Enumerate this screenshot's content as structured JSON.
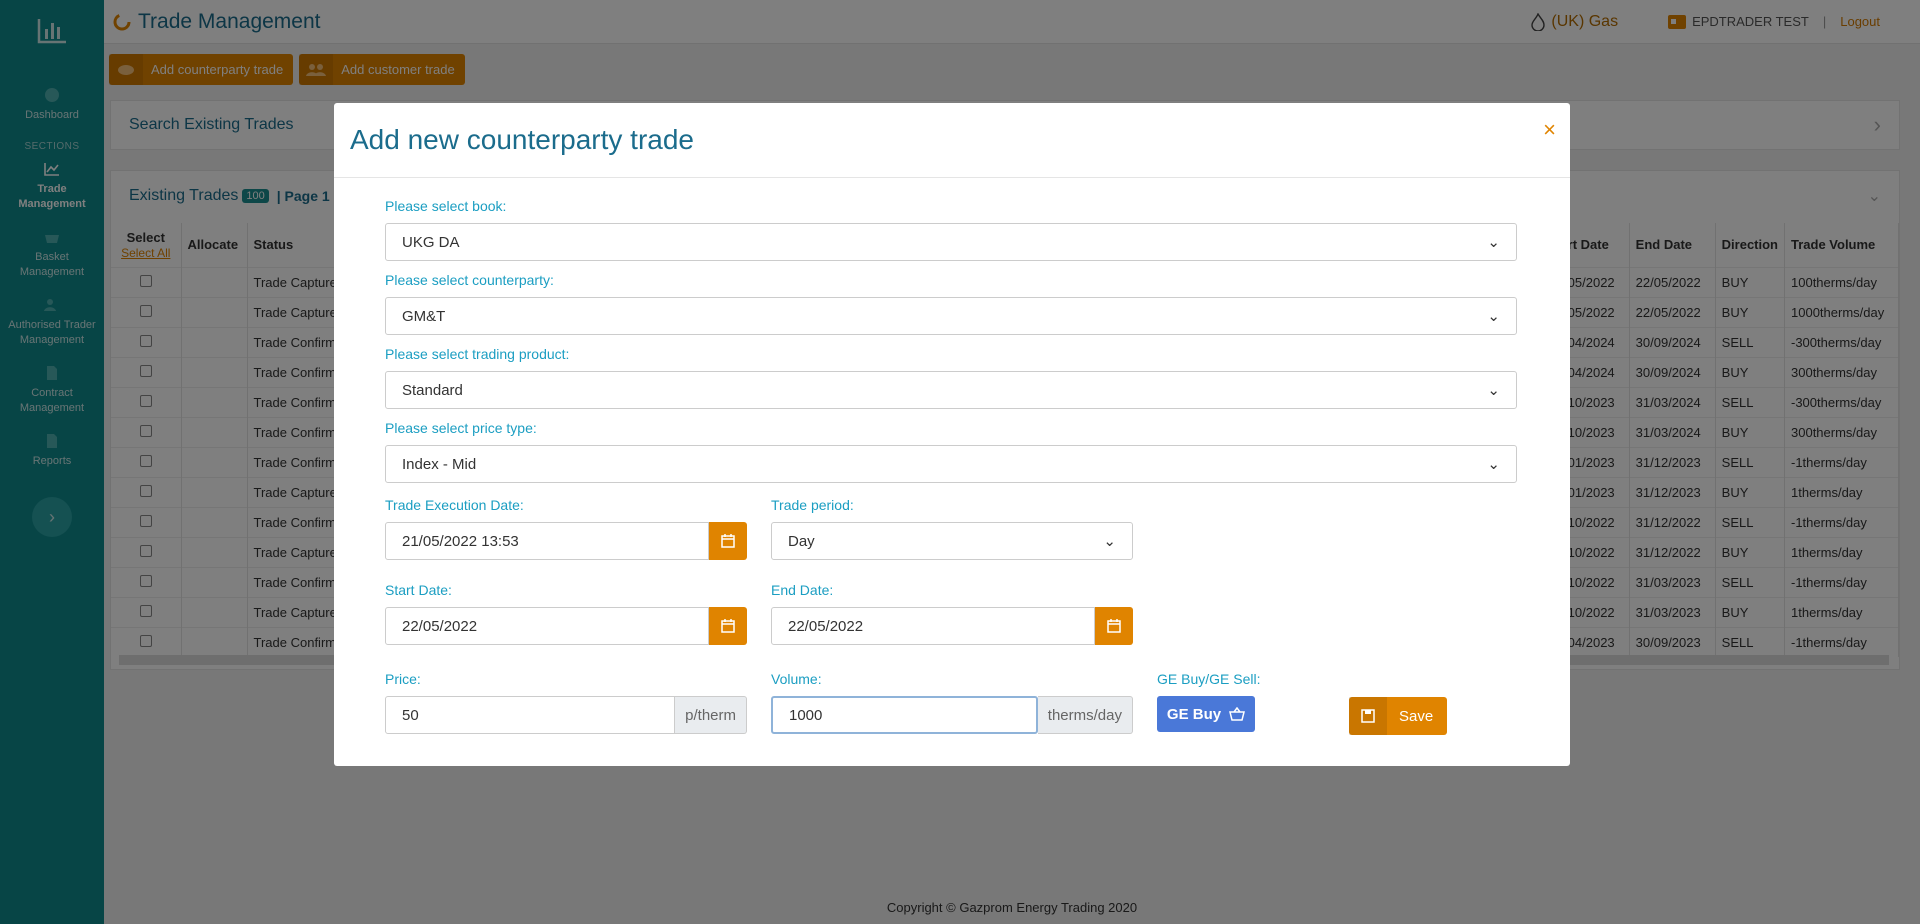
{
  "app": {
    "title": "Trade Management",
    "market": "(UK) Gas",
    "user": "EPDTRADER TEST",
    "logout": "Logout"
  },
  "sidebar": {
    "dashboard": "Dashboard",
    "section_label": "SECTIONS",
    "items": [
      {
        "label": "Trade Management",
        "icon": "line-chart-icon"
      },
      {
        "label": "Basket Management",
        "icon": "basket-icon"
      },
      {
        "label": "Authorised Trader Management",
        "icon": "user-check-icon"
      },
      {
        "label": "Contract Management",
        "icon": "file-icon"
      },
      {
        "label": "Reports",
        "icon": "file-icon"
      }
    ]
  },
  "toolbar": {
    "add_counterparty": "Add counterparty trade",
    "add_customer": "Add customer trade"
  },
  "search_panel": {
    "title": "Search Existing Trades"
  },
  "trades": {
    "title": "Existing Trades",
    "count": "100",
    "page_label": "| Page 1",
    "headers": {
      "select": "Select",
      "select_all": "Select All",
      "allocate": "Allocate",
      "status": "Status",
      "start_date": "rt Date",
      "end_date": "End Date",
      "direction": "Direction",
      "volume": "Trade Volume"
    },
    "rows": [
      {
        "status": "Trade Capture",
        "start": "05/2022",
        "end": "22/05/2022",
        "dir": "BUY",
        "vol": "100therms/day"
      },
      {
        "status": "Trade Capture",
        "start": "05/2022",
        "end": "22/05/2022",
        "dir": "BUY",
        "vol": "1000therms/day"
      },
      {
        "status": "Trade Confirm",
        "start": "04/2024",
        "end": "30/09/2024",
        "dir": "SELL",
        "vol": "-300therms/day"
      },
      {
        "status": "Trade Confirm",
        "start": "04/2024",
        "end": "30/09/2024",
        "dir": "BUY",
        "vol": "300therms/day"
      },
      {
        "status": "Trade Confirm",
        "start": "10/2023",
        "end": "31/03/2024",
        "dir": "SELL",
        "vol": "-300therms/day"
      },
      {
        "status": "Trade Confirm",
        "start": "10/2023",
        "end": "31/03/2024",
        "dir": "BUY",
        "vol": "300therms/day"
      },
      {
        "status": "Trade Confirm",
        "start": "01/2023",
        "end": "31/12/2023",
        "dir": "SELL",
        "vol": "-1therms/day"
      },
      {
        "status": "Trade Capture",
        "start": "01/2023",
        "end": "31/12/2023",
        "dir": "BUY",
        "vol": "1therms/day"
      },
      {
        "status": "Trade Confirm",
        "start": "10/2022",
        "end": "31/12/2022",
        "dir": "SELL",
        "vol": "-1therms/day"
      },
      {
        "status": "Trade Capture",
        "start": "10/2022",
        "end": "31/12/2022",
        "dir": "BUY",
        "vol": "1therms/day"
      },
      {
        "status": "Trade Confirm",
        "start": "10/2022",
        "end": "31/03/2023",
        "dir": "SELL",
        "vol": "-1therms/day"
      },
      {
        "status": "Trade Capture",
        "start": "10/2022",
        "end": "31/03/2023",
        "dir": "BUY",
        "vol": "1therms/day"
      },
      {
        "status": "Trade Confirm",
        "start": "04/2023",
        "end": "30/09/2023",
        "dir": "SELL",
        "vol": "-1therms/day"
      }
    ]
  },
  "footer": "Copyright © Gazprom Energy Trading 2020",
  "modal": {
    "title": "Add new counterparty trade",
    "close": "×",
    "book_label": "Please select book:",
    "book_value": "UKG DA",
    "counterparty_label": "Please select counterparty:",
    "counterparty_value": "GM&T",
    "product_label": "Please select trading product:",
    "product_value": "Standard",
    "price_type_label": "Please select price type:",
    "price_type_value": "Index - Mid",
    "exec_date_label": "Trade Execution Date:",
    "exec_date_value": "21/05/2022 13:53",
    "period_label": "Trade period:",
    "period_value": "Day",
    "start_label": "Start Date:",
    "start_value": "22/05/2022",
    "end_label": "End Date:",
    "end_value": "22/05/2022",
    "price_label": "Price:",
    "price_value": "50",
    "price_unit": "p/therm",
    "volume_label": "Volume:",
    "volume_value": "1000",
    "volume_unit": "therms/day",
    "ge_label": "GE Buy/GE Sell:",
    "ge_button": "GE Buy",
    "save_button": "Save"
  },
  "colors": {
    "brand_teal": "#0f8a8c",
    "accent_orange": "#e08400",
    "title_blue": "#1b6c8c",
    "label_blue": "#1b9ec2",
    "ge_blue": "#4a78d8"
  }
}
